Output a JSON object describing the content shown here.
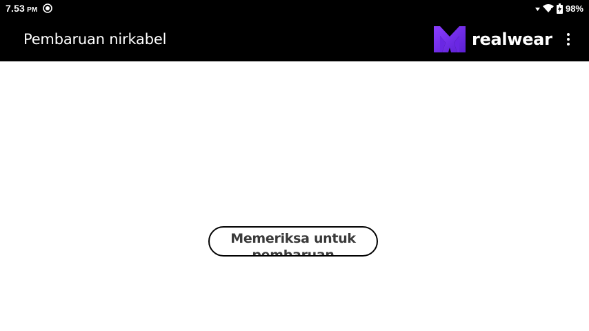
{
  "status_bar": {
    "time": "7.53",
    "ampm": "PM",
    "notification_icon": "radio-target-icon",
    "signal_icon": "signal-icon",
    "wifi_icon": "wifi-icon",
    "battery_icon": "battery-charging-icon",
    "battery_percent": "98%"
  },
  "app_bar": {
    "title": "Pembaruan nirkabel",
    "brand_name": "realwear",
    "brand_logo_icon": "realwear-logo-icon",
    "overflow_icon": "more-vertical-icon"
  },
  "main": {
    "check_button_label": "Memeriksa untuk pembaruan"
  },
  "colors": {
    "bar_background": "#000000",
    "content_background": "#ffffff",
    "brand_purple": "#7a2cf5"
  }
}
